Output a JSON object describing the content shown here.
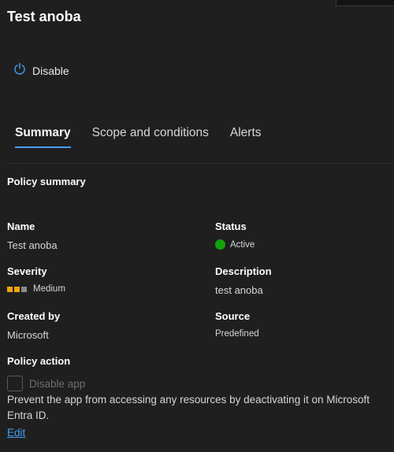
{
  "header": {
    "title": "Test anoba"
  },
  "toolbar": {
    "disable_label": "Disable"
  },
  "tabs": [
    {
      "label": "Summary",
      "active": true
    },
    {
      "label": "Scope and conditions",
      "active": false
    },
    {
      "label": "Alerts",
      "active": false
    }
  ],
  "summary": {
    "section_title": "Policy summary",
    "name": {
      "label": "Name",
      "value": "Test anoba"
    },
    "status": {
      "label": "Status",
      "value": "Active",
      "color": "#13a10e"
    },
    "severity": {
      "label": "Severity",
      "value": "Medium",
      "level": 2,
      "max": 3,
      "colors": {
        "filled": "#f0a30a",
        "empty": "#8a8a8a"
      }
    },
    "description": {
      "label": "Description",
      "value": "test anoba"
    },
    "created_by": {
      "label": "Created by",
      "value": "Microsoft"
    },
    "source": {
      "label": "Source",
      "value": "Predefined"
    }
  },
  "policy_action": {
    "title": "Policy action",
    "checkbox_label": "Disable app",
    "checked": false,
    "description": "Prevent the app from accessing any resources by deactivating it on Microsoft Entra ID.",
    "edit_label": "Edit"
  },
  "colors": {
    "accent": "#479ef5",
    "background": "#1f1f1f"
  }
}
